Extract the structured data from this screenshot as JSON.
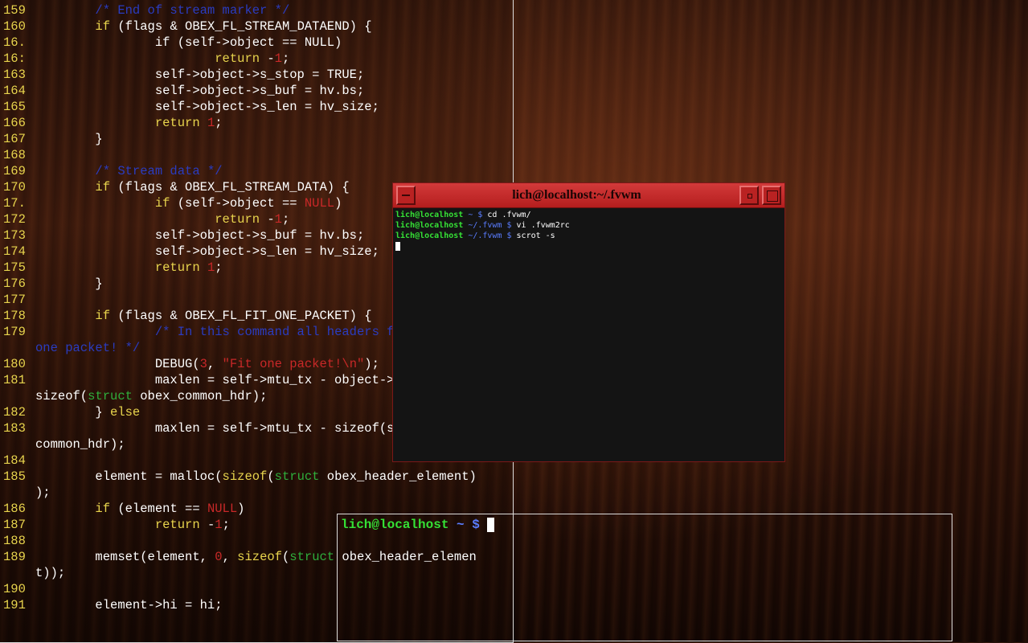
{
  "editor": {
    "lines": [
      {
        "ln": "159",
        "parts": [
          [
            "",
            "        "
          ],
          [
            "cm",
            "/* End of stream marker */"
          ]
        ]
      },
      {
        "ln": "160",
        "parts": [
          [
            "",
            "        "
          ],
          [
            "kw",
            "if"
          ],
          [
            "",
            " (flags & OBEX_FL_STREAM_DATAEND) {"
          ]
        ]
      },
      {
        "ln": "16.",
        "parts": [
          [
            "",
            "                if (self->object == NULL)"
          ]
        ]
      },
      {
        "ln": "16:",
        "parts": [
          [
            "",
            "                        "
          ],
          [
            "kw",
            "return"
          ],
          [
            "",
            " -"
          ],
          [
            "nm",
            "1"
          ],
          [
            "",
            ";"
          ]
        ]
      },
      {
        "ln": "163",
        "parts": [
          [
            "",
            "                self->object->s_stop = TRUE;"
          ]
        ]
      },
      {
        "ln": "164",
        "parts": [
          [
            "",
            "                self->object->s_buf = hv.bs;"
          ]
        ]
      },
      {
        "ln": "165",
        "parts": [
          [
            "",
            "                self->object->s_len = hv_size;"
          ]
        ]
      },
      {
        "ln": "166",
        "parts": [
          [
            "",
            "                "
          ],
          [
            "kw",
            "return"
          ],
          [
            "",
            " "
          ],
          [
            "nm",
            "1"
          ],
          [
            "",
            ";"
          ]
        ]
      },
      {
        "ln": "167",
        "parts": [
          [
            "",
            "        }"
          ]
        ]
      },
      {
        "ln": "168",
        "parts": [
          [
            "",
            ""
          ]
        ]
      },
      {
        "ln": "169",
        "parts": [
          [
            "",
            "        "
          ],
          [
            "cm",
            "/* Stream data */"
          ]
        ]
      },
      {
        "ln": "170",
        "parts": [
          [
            "",
            "        "
          ],
          [
            "kw",
            "if"
          ],
          [
            "",
            " (flags & OBEX_FL_STREAM_DATA) {"
          ]
        ]
      },
      {
        "ln": "17.",
        "parts": [
          [
            "",
            "                "
          ],
          [
            "kw",
            "if"
          ],
          [
            "",
            " (self->object == "
          ],
          [
            "nm",
            "NULL"
          ],
          [
            "",
            ")"
          ]
        ]
      },
      {
        "ln": "172",
        "parts": [
          [
            "",
            "                        "
          ],
          [
            "kw",
            "return"
          ],
          [
            "",
            " -"
          ],
          [
            "nm",
            "1"
          ],
          [
            "",
            ";"
          ]
        ]
      },
      {
        "ln": "173",
        "parts": [
          [
            "",
            "                self->object->s_buf = hv.bs;"
          ]
        ]
      },
      {
        "ln": "174",
        "parts": [
          [
            "",
            "                self->object->s_len = hv_size;"
          ]
        ]
      },
      {
        "ln": "175",
        "parts": [
          [
            "",
            "                "
          ],
          [
            "kw",
            "return"
          ],
          [
            "",
            " "
          ],
          [
            "nm",
            "1"
          ],
          [
            "",
            ";"
          ]
        ]
      },
      {
        "ln": "176",
        "parts": [
          [
            "",
            "        }"
          ]
        ]
      },
      {
        "ln": "177",
        "parts": [
          [
            "",
            ""
          ]
        ]
      },
      {
        "ln": "178",
        "parts": [
          [
            "",
            "        "
          ],
          [
            "kw",
            "if"
          ],
          [
            "",
            " (flags & OBEX_FL_FIT_ONE_PACKET) {"
          ]
        ]
      },
      {
        "ln": "179",
        "parts": [
          [
            "",
            "                "
          ],
          [
            "cm",
            "/* In this command all headers fit in"
          ]
        ]
      },
      {
        "ln": "",
        "parts": [
          [
            "cm",
            "one packet! */"
          ]
        ]
      },
      {
        "ln": "180",
        "parts": [
          [
            "",
            "                DEBUG("
          ],
          [
            "nm",
            "3"
          ],
          [
            "",
            ", "
          ],
          [
            "st",
            "\"Fit one packet!\\n\""
          ],
          [
            "",
            ");"
          ]
        ]
      },
      {
        "ln": "181",
        "parts": [
          [
            "",
            "                maxlen = self->mtu_tx - object->totallen -"
          ]
        ]
      },
      {
        "ln": "",
        "parts": [
          [
            "",
            "sizeof("
          ],
          [
            "ty",
            "struct"
          ],
          [
            "",
            " obex_common_hdr);"
          ]
        ]
      },
      {
        "ln": "182",
        "parts": [
          [
            "",
            "        } "
          ],
          [
            "kw",
            "else"
          ]
        ]
      },
      {
        "ln": "183",
        "parts": [
          [
            "",
            "                maxlen = self->mtu_tx - sizeof(struct obex_"
          ]
        ]
      },
      {
        "ln": "",
        "parts": [
          [
            "",
            "common_hdr);"
          ]
        ]
      },
      {
        "ln": "184",
        "parts": [
          [
            "",
            ""
          ]
        ]
      },
      {
        "ln": "185",
        "parts": [
          [
            "",
            "        element = malloc("
          ],
          [
            "kw",
            "sizeof"
          ],
          [
            "",
            "("
          ],
          [
            "ty",
            "struct"
          ],
          [
            "",
            " obex_header_element)"
          ]
        ]
      },
      {
        "ln": "",
        "parts": [
          [
            "",
            ");"
          ]
        ]
      },
      {
        "ln": "186",
        "parts": [
          [
            "",
            "        "
          ],
          [
            "kw",
            "if"
          ],
          [
            "",
            " (element == "
          ],
          [
            "nm",
            "NULL"
          ],
          [
            "",
            ")"
          ]
        ]
      },
      {
        "ln": "187",
        "parts": [
          [
            "",
            "                "
          ],
          [
            "kw",
            "return"
          ],
          [
            "",
            " -"
          ],
          [
            "nm",
            "1"
          ],
          [
            "",
            ";"
          ]
        ]
      },
      {
        "ln": "188",
        "parts": [
          [
            "",
            ""
          ]
        ]
      },
      {
        "ln": "189",
        "parts": [
          [
            "",
            "        memset(element, "
          ],
          [
            "nm",
            "0"
          ],
          [
            "",
            ", "
          ],
          [
            "kw",
            "sizeof"
          ],
          [
            "",
            "("
          ],
          [
            "ty",
            "struct"
          ],
          [
            "",
            " obex_header_elemen"
          ]
        ]
      },
      {
        "ln": "",
        "parts": [
          [
            "",
            "t));"
          ]
        ]
      },
      {
        "ln": "190",
        "parts": [
          [
            "",
            ""
          ]
        ]
      },
      {
        "ln": "191",
        "parts": [
          [
            "",
            "        element->hi = hi;"
          ]
        ]
      }
    ]
  },
  "term1": {
    "title": "lich@localhost:~/.fvwm",
    "lines": [
      {
        "user": "lich@localhost",
        "path": " ~ $",
        "cmd": " cd .fvwm/"
      },
      {
        "user": "lich@localhost",
        "path": " ~/.fvwm $",
        "cmd": " vi .fvwm2rc"
      },
      {
        "user": "lich@localhost",
        "path": " ~/.fvwm $",
        "cmd": " scrot -s"
      }
    ]
  },
  "term2": {
    "user": "lich@localhost",
    "path": " ~ $ "
  },
  "icons": {
    "minimize": "minimize-icon",
    "iconify": "iconify-icon",
    "maximize": "maximize-icon"
  },
  "colors": {
    "titlebar": "#c42a2a",
    "prompt_user": "#35e035",
    "prompt_path": "#5a7dff",
    "line_number": "#e8d44d"
  }
}
